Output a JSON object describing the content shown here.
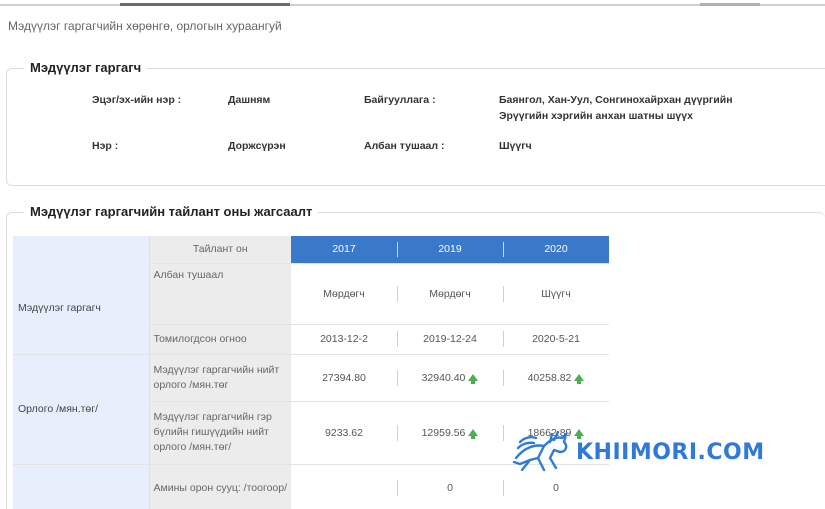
{
  "page": {
    "title": "Мэдүүлэг гаргагчийн хөрөнгө, орлогын хураангуй"
  },
  "declarant": {
    "legend": "Мэдүүлэг гаргагч",
    "patronymic_label": "Эцэг/эх-ийн нэр :",
    "patronymic_value": "Дашням",
    "org_label": "Байгууллага :",
    "org_value_line1": "Баянгол, Хан-Уул, Сонгинохайрхан дүүргийн",
    "org_value_line2": "Эрүүгийн хэргийн анхан шатны шүүх",
    "name_label": "Нэр :",
    "name_value": "Доржсүрэн",
    "position_label": "Албан тушаал :",
    "position_value": "Шүүгч"
  },
  "summary": {
    "legend": "Мэдүүлэг гаргагчийн тайлант оны жагсаалт",
    "header_label": "Тайлант он",
    "years": [
      "2017",
      "2019",
      "2020"
    ],
    "sections": [
      {
        "category": "Мэдүүлэг гаргагч",
        "rows": [
          {
            "label": "Албан тушаал",
            "values": [
              "Мөрдөгч",
              "Мөрдөгч",
              "Шүүгч"
            ]
          },
          {
            "label": "Томилогдсон огноо",
            "values": [
              "2013-12-2",
              "2019-12-24",
              "2020-5-21"
            ]
          }
        ]
      },
      {
        "category": "Орлого /мян.төг/",
        "rows": [
          {
            "label": "Мэдүүлэг гаргагчийн нийт орлого /мян.төг",
            "values": [
              "27394.80",
              "32940.40",
              "40258.82"
            ],
            "increase": [
              false,
              true,
              true
            ]
          },
          {
            "label": "Мэдүүлэг гаргагчийн гэр бүлийн гишүүдийн нийт орлого /мян.төг/",
            "values": [
              "9233.62",
              "12959.56",
              "18662.89"
            ],
            "increase": [
              false,
              true,
              true
            ]
          }
        ]
      },
      {
        "category": "",
        "rows": [
          {
            "label": "Амины орон сууц: /тоогоор/",
            "values": [
              "",
              "0",
              "0"
            ]
          }
        ]
      }
    ]
  },
  "watermark": {
    "text": "KHIIMORI.COM",
    "icon": "horse-logo-icon",
    "color": "#2f7ad9"
  },
  "colors": {
    "header_blue": "#3a78c9",
    "category_bg": "#e7effc",
    "label_bg": "#ececec",
    "increase_arrow": "#4caf50"
  }
}
